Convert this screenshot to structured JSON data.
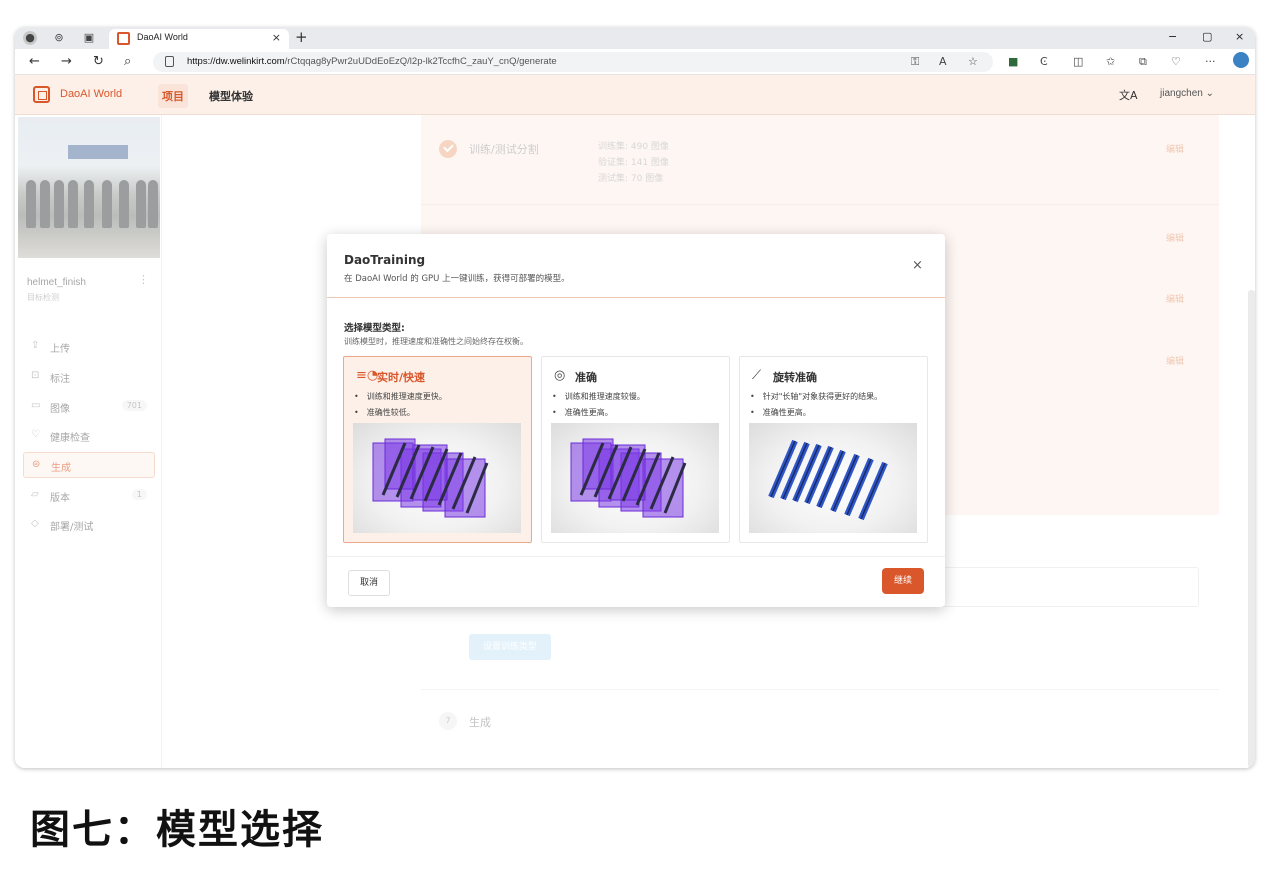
{
  "browser": {
    "tab_title": "DaoAI World",
    "tab_close": "×",
    "new_tab": "+",
    "url_host": "https://dw.welinkirt.com",
    "url_path": "/rCtqqag8yPwr2uUDdEoEzQ/l2p-lk2TccfhC_zauY_cnQ/generate",
    "window_controls": [
      "−",
      "▢",
      "×"
    ]
  },
  "header": {
    "logo_text": "DaoAI World",
    "nav": [
      "项目",
      "模型体验"
    ],
    "user": "jiangchen ⌄",
    "lang_icon": "文A",
    "brand_color": "#d9572b"
  },
  "sidebar": {
    "project_name": "helmet_finish",
    "project_type": "目标检测",
    "items": [
      {
        "icon": "upload-icon",
        "glyph": "⇪",
        "label": "上传",
        "count": ""
      },
      {
        "icon": "label-icon",
        "glyph": "⊡",
        "label": "标注",
        "count": ""
      },
      {
        "icon": "image-icon",
        "glyph": "▭",
        "label": "图像",
        "count": "701"
      },
      {
        "icon": "health-icon",
        "glyph": "♡",
        "label": "健康检查",
        "count": ""
      },
      {
        "icon": "generate-icon",
        "glyph": "⊜",
        "label": "生成",
        "count": ""
      },
      {
        "icon": "version-icon",
        "glyph": "▱",
        "label": "版本",
        "count": "1"
      },
      {
        "icon": "deploy-icon",
        "glyph": "◇",
        "label": "部署/测试",
        "count": ""
      }
    ]
  },
  "main": {
    "split": {
      "title": "训练/测试分割",
      "lines": [
        "训练集: 490 图像",
        "验证集: 141 图像",
        "测试集: 70 图像"
      ]
    },
    "edit_label": "编辑",
    "set_type_button": "设置训练类型",
    "step7": {
      "num": "7",
      "label": "生成"
    }
  },
  "modal": {
    "title": "DaoTraining",
    "subtitle": "在 DaoAI World 的 GPU 上一键训练，获得可部署的模型。",
    "close": "×",
    "section_label": "选择模型类型:",
    "section_sub": "训练模型时，推理速度和准确性之间始终存在权衡。",
    "cards": [
      {
        "title": "实时/快速",
        "icon": "speed-icon",
        "bullets": [
          "训练和推理速度更快。",
          "准确性较低。"
        ],
        "selected": true
      },
      {
        "title": "准确",
        "icon": "target-icon",
        "bullets": [
          "训练和推理速度较慢。",
          "准确性更高。"
        ],
        "selected": false
      },
      {
        "title": "旋转准确",
        "icon": "rotate-icon",
        "bullets": [
          "针对\"长轴\"对象获得更好的结果。",
          "准确性更高。"
        ],
        "selected": false
      }
    ],
    "cancel": "取消",
    "continue": "继续"
  },
  "caption": "图七：模型选择"
}
